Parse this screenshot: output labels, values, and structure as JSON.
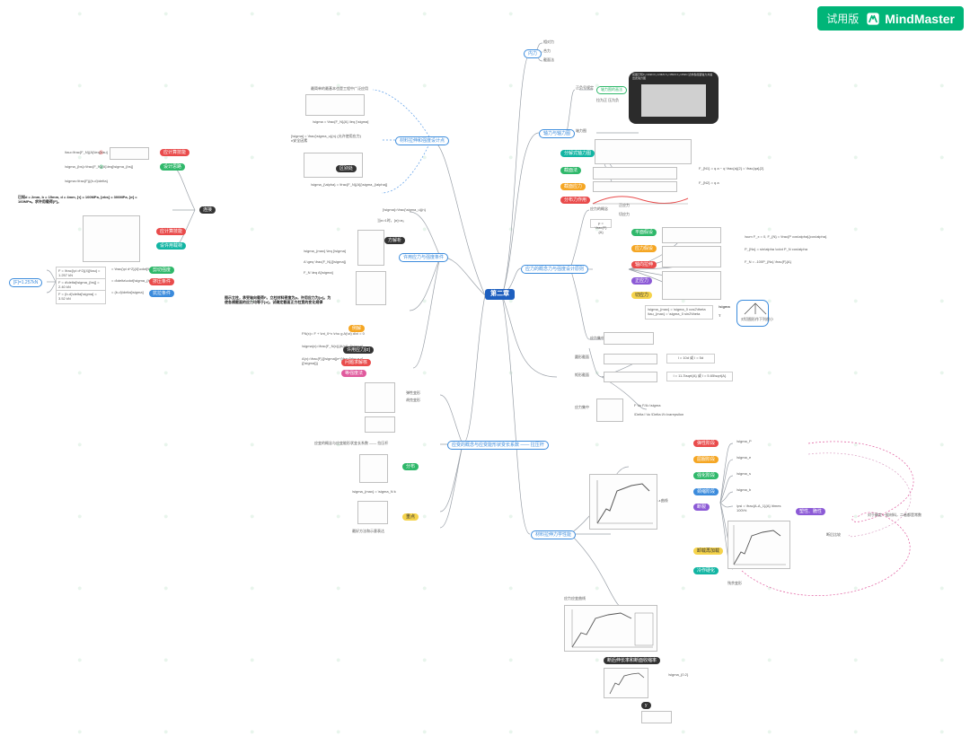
{
  "app": {
    "trial_label": "试用版",
    "brand": "MindMaster"
  },
  "center": {
    "label": "第二章"
  },
  "colors": {
    "center": "#1e5fbf",
    "blue": "#3b8bdc",
    "green": "#2fb86a",
    "teal": "#12b5a3",
    "orange": "#f5a623",
    "red": "#e94b4b",
    "pink": "#e05a9d",
    "purple": "#8c5ad6",
    "yellow": "#f5d34b",
    "black": "#333333",
    "gray": "#9aa0a8"
  },
  "right": {
    "r1": {
      "title_outline": "内力",
      "items": [
        "相对力",
        "合力",
        "截面法"
      ]
    },
    "r2": {
      "title_outline": "轴力与轴力图",
      "sub1": "正负号规定",
      "sub1_child_outline": "轴力图的画法",
      "sub1_hint": "拉为正 压为负",
      "sub2": "轴力图",
      "items": [
        "分解式轴力图",
        "截面法",
        "截面应力",
        "分布力作用"
      ],
      "eq1": "F_{N1} = q a − q \\frac{a}{2} = \\frac{qa}{2}",
      "eq2": "F_{N2} = q a",
      "dark_caption": "如图已知F₁=10kN  F₂=20kN  F₃=35kN F₄=25kN 试求各截面轴力并画出此轴力图"
    },
    "r3": {
      "title_outline": "应力的概念力与强度设计原则",
      "sub_indent": "应力的概念",
      "sub_items": [
        "正应力",
        "切应力"
      ],
      "formula_box": "p = \\frac{F}{A}",
      "group_items": [
        "平面假设",
        "应力假设",
        "轴向拉伸",
        "正应力",
        "切应力",
        "应力集中"
      ],
      "eqs_right": [
        "\\sum F_x = 0,   F_{N} = \\frac{P cos\\alpha}{cos\\alpha}",
        "P_{Ns} = sin\\alpha \\cdot P_N cos\\alpha",
        "F_N = -100P_{Ns} \\frac{F}{A}"
      ],
      "eqs_bottom": [
        "\\sigma_{max} = \\sigma_0 cos2\\theta",
        "\\tau_{max} = \\sigma_0 sin2\\theta",
        "\\sigma",
        "T"
      ],
      "box_note": "对切图形作下列很小"
    },
    "r3b": {
      "sub_box": "应力集中",
      "eq_box": "试件",
      "diag_labels": [
        "圆形截面",
        "矩形截面",
        "应力集中"
      ],
      "eqs": [
        "l = 10d 或 l = 5d",
        "l = 11.3\\sqrt{A} 或 l = 5.65\\sqrt{A}",
        "F \\to F/A=\\sigma",
        "\\Delta l \\to \\Delta l/l=\\varepsilon"
      ]
    },
    "r5": {
      "title_outline": "材料拉伸力学性能",
      "sub": "σ-ε曲线",
      "group_titles": [
        "弹性阶段",
        "屈服阶段",
        "强化阶段",
        "颈缩阶段",
        "断裂"
      ],
      "eqs": [
        "\\sigma_P",
        "\\sigma_e",
        "\\sigma_s",
        "\\sigma_b",
        "\\psi = \\frac{A-A_1}{A} \\times 100\\%"
      ],
      "bubble": "塑性、脆性",
      "far_right": "对于确定一般材料，二者都是常数",
      "far_right2": "断后比较",
      "lower_group": [
        "卸载再加载",
        "冷作硬化",
        "残余变形"
      ],
      "dk": "断后伸长率和断面收缩率",
      "eq_lower": "\\sigma_{0.2}",
      "bottom_box": "y"
    }
  },
  "left": {
    "l1": {
      "title_outline": "材料拉伸和强度设计点",
      "note_top": "最简单的最基本也是工程中广泛应用",
      "eq1": "\\sigma = \\frac{F_N}{A} \\leq [\\sigma]",
      "eq2": "[\\sigma] = \\frac{\\sigma_u}{n} (允许使用应力)  n安全因素",
      "eq3": "\\sigma_{\\alpha} = \\frac{F_N}{A}[\\sigma_{\\alpha}]",
      "pill": "区别处"
    },
    "l2": {
      "title_outline": "许用应力与强度条件",
      "eq_top": "[\\sigma]=\\frac{\\sigma_u}{n}",
      "note": "当n>1时，[σ]<σᵤ",
      "sub_dark": "方解析",
      "pill_orange": "例解",
      "eqs": [
        "\\sigma_{max} \\leq [\\sigma]",
        "A \\geq \\frac{F_N}{[\\sigma]}",
        "F_N \\leq A[\\sigma]"
      ]
    },
    "l3": {
      "title_outline": "应力集中",
      "sub_dark": "许用应力[σ]",
      "pill_pink": "等强度法",
      "note": "图示立柱，承受轴向载荷F。立柱材料密度为ρ，许用应力为[σ]。为使各横截面的应力均等于[σ]，试确定截面正方柱宽的变化规律",
      "eq_block": [
        "FN(x)= F + \\int_0^x \\rho g A(\\xi) d\\xi = 0",
        "\\sigma(x)=\\frac{F_N(x)}{A(x)}=[\\sigma]",
        "A(x)=\\frac{F}{[\\sigma]}e^{\\frac{\\rho g x}{[\\sigma]}}"
      ],
      "pill_end": "问题求解核"
    },
    "l4": {
      "title_outline": "应变的概念与应变能形状变长系数 —— 拉压杆",
      "sub1": "弹性变形",
      "sub2": "胡克变形",
      "eq": "\\sigma_{max} = \\sigma_N k"
    },
    "left_calc": {
      "problem": "已知d = 2mm, b = 15mm, d = 4mm, [τ] = 100MPa, [σbs] = 300MPa, [σ] = 160MPa。求许用载荷[F]。",
      "eqs_top": [
        "\\tau=\\frac{F_N}{A}\\leq[\\tau]",
        "\\sigma_{bs}=\\frac{F_N}{A}\\leq[\\sigma_{bs}]",
        "\\sigma=\\frac{F}{(b-d)\\delta}"
      ],
      "dot_red": "①",
      "dot_green": "②",
      "green_pill": "设计思路",
      "red_pill1": "应计算技能",
      "red_pill2": "应计算技能",
      "teal_pill": "设许用载荷",
      "blue_result": "[F]=1.257kN",
      "rows": [
        {
          "eq": "F = \\frac{\\pi d^2}{4}[\\tau] = 1.257 kN",
          "rhs": "= \\frac{\\pi d^2}{4}\\cdot[\\tau]",
          "tag": "剪切强度"
        },
        {
          "eq": "F = d\\delta[\\sigma_{bs}] = 2.40 kN",
          "rhs": "= d\\delta\\cdot[\\sigma_{bs}]",
          "tag": "挤压条件"
        },
        {
          "eq": "F = (b-d)\\delta[\\sigma] = 3.52 kN",
          "rhs": "= (b-d)\\delta[\\sigma]",
          "tag": "抗拉条件"
        }
      ]
    },
    "link": {
      "title_pill": "连接"
    }
  },
  "icons": {
    "logo": "mindmaster-logo-icon",
    "wm": "watermark-logo"
  }
}
